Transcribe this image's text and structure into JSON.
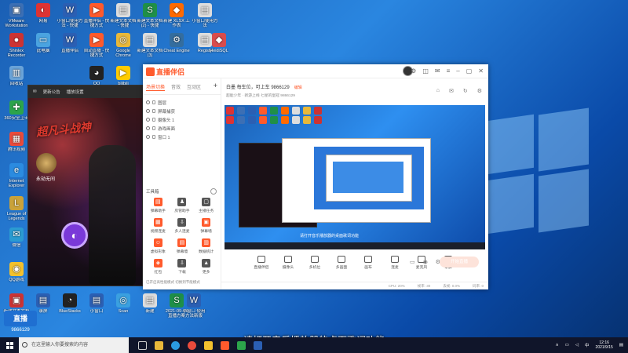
{
  "desktop": {
    "icons": [
      {
        "label": "VMware Workstation",
        "color": "#3c6fb4",
        "glyph": "▣"
      },
      {
        "label": "网易",
        "color": "#d33",
        "glyph": "◐"
      },
      {
        "label": "小窗口使用方法 - 快捷",
        "color": "#2b5fb3",
        "glyph": "W"
      },
      {
        "label": "直播伴侣 - 快捷方式",
        "color": "#ff5a2c",
        "glyph": "▶"
      },
      {
        "label": "新建文本文档 - 快捷",
        "color": "#ddd",
        "glyph": "▤"
      },
      {
        "label": "新建文本文档 (2) - 快捷",
        "color": "#1f8f48",
        "glyph": "S"
      },
      {
        "label": "新建 XLSX 工作表",
        "color": "#ff6a00",
        "glyph": "◆"
      },
      {
        "label": "小窗口使用方法",
        "color": "#ddd",
        "glyph": "▤"
      },
      {
        "label": "Shinlex Recorder",
        "color": "#c33",
        "glyph": "●"
      },
      {
        "label": "此电脑",
        "color": "#4aa3e0",
        "glyph": "▭"
      },
      {
        "label": "直播伴侣",
        "color": "#2b5fb3",
        "glyph": "W"
      },
      {
        "label": "自动直播 - 快捷方式",
        "color": "#ff5a2c",
        "glyph": "▶"
      },
      {
        "label": "Google Chrome",
        "color": "#e8b83a",
        "glyph": "◎"
      },
      {
        "label": "新建文本文档 (3)",
        "color": "#ddd",
        "glyph": "▤"
      },
      {
        "label": "Cheat Engine",
        "color": "#346d9e",
        "glyph": "⚙"
      },
      {
        "label": "Registy",
        "color": "#ddd",
        "glyph": "▤"
      },
      {
        "label": "HeidiSQL",
        "color": "#d94c4c",
        "glyph": "◆"
      },
      {
        "label": "回收站",
        "color": "#6aa3d8",
        "glyph": "▥"
      },
      {
        "label": "QQ",
        "color": "#222",
        "glyph": "◕"
      },
      {
        "label": "bilibili",
        "color": "#ffcc00",
        "glyph": "▶"
      },
      {
        "label": "360安全卫士",
        "color": "#2ca44b",
        "glyph": "✚"
      },
      {
        "label": "腾讯视频",
        "color": "#e94b3c",
        "glyph": "▦"
      },
      {
        "label": "Internet Explorer",
        "color": "#2b8be0",
        "glyph": "e"
      },
      {
        "label": "League of Legends",
        "color": "#c9a23a",
        "glyph": "L"
      },
      {
        "label": "微信",
        "color": "#2b9bd1",
        "glyph": "✉"
      },
      {
        "label": "QQ游戏",
        "color": "#f2c12e",
        "glyph": "◉"
      },
      {
        "label": "新建文本文档 (4)",
        "color": "#c33",
        "glyph": "▣"
      },
      {
        "label": "录屏",
        "color": "#2b5fb3",
        "glyph": "▤"
      },
      {
        "label": "BlueStacks",
        "color": "#222",
        "glyph": "◔"
      },
      {
        "label": "小窗口",
        "color": "#2b5fb3",
        "glyph": "▤"
      },
      {
        "label": "Scan",
        "color": "#3aa0e0",
        "glyph": "◎"
      },
      {
        "label": "新建",
        "color": "#ddd",
        "glyph": "▤"
      },
      {
        "label": "2021-09-15 直播方案",
        "color": "#1f8f48",
        "glyph": "S"
      },
      {
        "label": "小窗口 使用方法新版",
        "color": "#2b5fb3",
        "glyph": "W"
      },
      {
        "label": "录屏方案",
        "color": "#2b5fb3",
        "glyph": "W"
      }
    ]
  },
  "phone_window": {
    "tabs": [
      "✉",
      "更新公告",
      "播放设置"
    ],
    "game_title": "超凡斗战神",
    "game_sub": "永劫无间",
    "live_glyph": "◐"
  },
  "app": {
    "brand": "直播伴侣",
    "left_tabs": {
      "scene": "场景切换",
      "audio": "音效",
      "other": "互动区",
      "add": "+"
    },
    "scenes": [
      "图层",
      "屏幕捕获",
      "摄像头 1",
      "游戏画面",
      "窗口 1"
    ],
    "tools_title": "工具箱",
    "tools": [
      {
        "label": "弹幕助手",
        "color": "#ff5a2c",
        "glyph": "▤"
      },
      {
        "label": "房管助手",
        "color": "#555",
        "glyph": "♟"
      },
      {
        "label": "主播任务",
        "color": "#555",
        "glyph": "▢"
      },
      {
        "label": "视频连麦",
        "color": "#ff5a2c",
        "glyph": "▦"
      },
      {
        "label": "多人连麦",
        "color": "#555",
        "glyph": "⇩"
      },
      {
        "label": "弹幕墙",
        "color": "#ff5a2c",
        "glyph": "▣"
      },
      {
        "label": "虚拟形象",
        "color": "#ff5a2c",
        "glyph": "☺"
      },
      {
        "label": "弹幕墙",
        "color": "#ff5a2c",
        "glyph": "▤"
      },
      {
        "label": "数据统计",
        "color": "#ff5a2c",
        "glyph": "▥"
      },
      {
        "label": "红包",
        "color": "#ff5a2c",
        "glyph": "◈"
      },
      {
        "label": "下载",
        "color": "#555",
        "glyph": "⇩"
      },
      {
        "label": "更多",
        "color": "#555",
        "glyph": "▲"
      }
    ],
    "left_footer": "已开启高性能模式 切换到节能模式",
    "stream": {
      "name": "白墨 每车位，可上车 9866129",
      "tag": "编辑",
      "sub": "超能少年 · 新游上线   七星的皇冠   9866129"
    },
    "header_icons": [
      "⌂",
      "✉",
      "↻",
      "⚙"
    ],
    "preview_note": "请打开音乐播放器的桌面歌词功能",
    "controls": [
      "直播伴侣",
      "摄像头",
      "多机位",
      "多画面",
      "画布",
      "连麦",
      "麦克风",
      "录屏"
    ],
    "start_button": "开始直播",
    "status": [
      "CPU: 20%",
      "帧率: 30",
      "丢帧: 0.0%",
      "码率: 0"
    ]
  },
  "watermark": {
    "logo": "直播",
    "number": "9866129"
  },
  "subtitle": "请打开音乐播放器的桌面歌词功能",
  "taskbar": {
    "search_placeholder": "在这里输入你要搜索的内容",
    "time": "12:16",
    "date": "2021/9/15",
    "tray_lang": "中"
  }
}
